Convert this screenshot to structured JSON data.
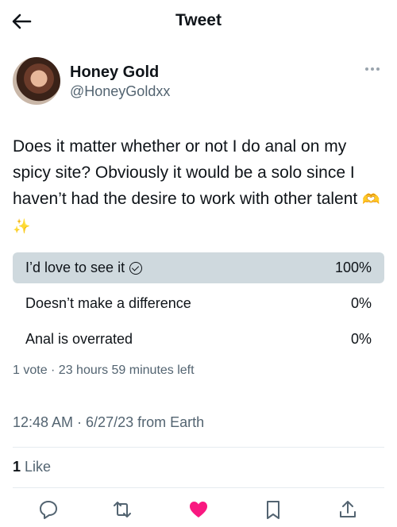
{
  "header": {
    "title": "Tweet"
  },
  "author": {
    "name": "Honey Gold",
    "handle": "@HoneyGoldxx"
  },
  "tweet": {
    "text": "Does it matter whether or not I do anal on my spicy site? Obviously it would be a solo since I haven’t had the desire to work with other talent",
    "emoji": "🫶✨"
  },
  "poll": {
    "options": [
      {
        "label": "I’d love to see it",
        "percent": "100%",
        "value": 100,
        "selected": true
      },
      {
        "label": "Doesn’t make a difference",
        "percent": "0%",
        "value": 0,
        "selected": false
      },
      {
        "label": "Anal is overrated",
        "percent": "0%",
        "value": 0,
        "selected": false
      }
    ],
    "meta": "1 vote · 23 hours 59 minutes left"
  },
  "timestamp": "12:48 AM · 6/27/23 from Earth",
  "likes": {
    "count": "1",
    "label": " Like"
  },
  "colors": {
    "like": "#f91880",
    "fill": "#cfd9de",
    "secondary": "#536471"
  },
  "icons": [
    "back-arrow-icon",
    "more-icon",
    "check-circle-icon",
    "reply-icon",
    "retweet-icon",
    "like-icon",
    "bookmark-icon",
    "share-icon"
  ]
}
